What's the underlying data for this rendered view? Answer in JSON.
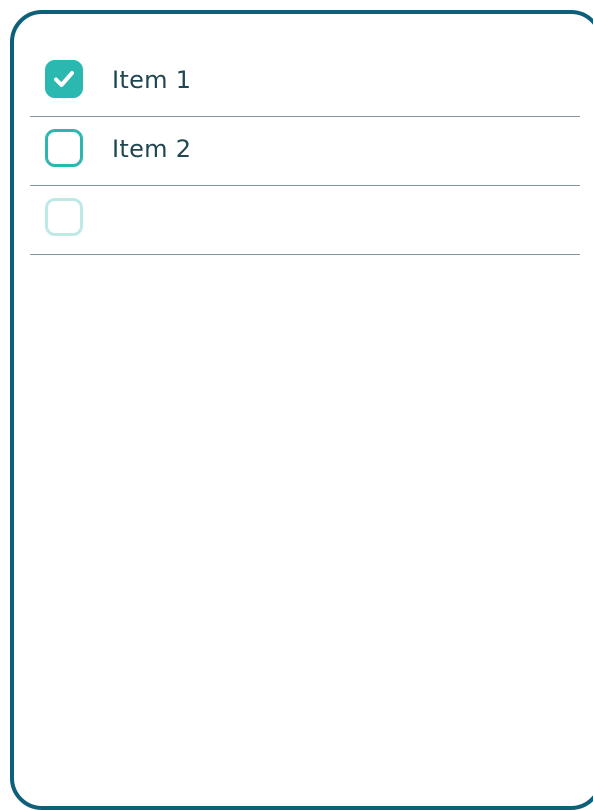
{
  "colors": {
    "card_border": "#0d5f7a",
    "checkbox_accent": "#2bb8b0",
    "checkbox_placeholder": "#bfe9e6",
    "divider": "#7f97a2",
    "text": "#1f4652"
  },
  "checklist": {
    "items": [
      {
        "label": "Item 1",
        "checked": true,
        "icon": "checkmark-icon"
      },
      {
        "label": "Item 2",
        "checked": false
      },
      {
        "label": "",
        "checked": false,
        "state": "new-item-placeholder"
      }
    ]
  }
}
